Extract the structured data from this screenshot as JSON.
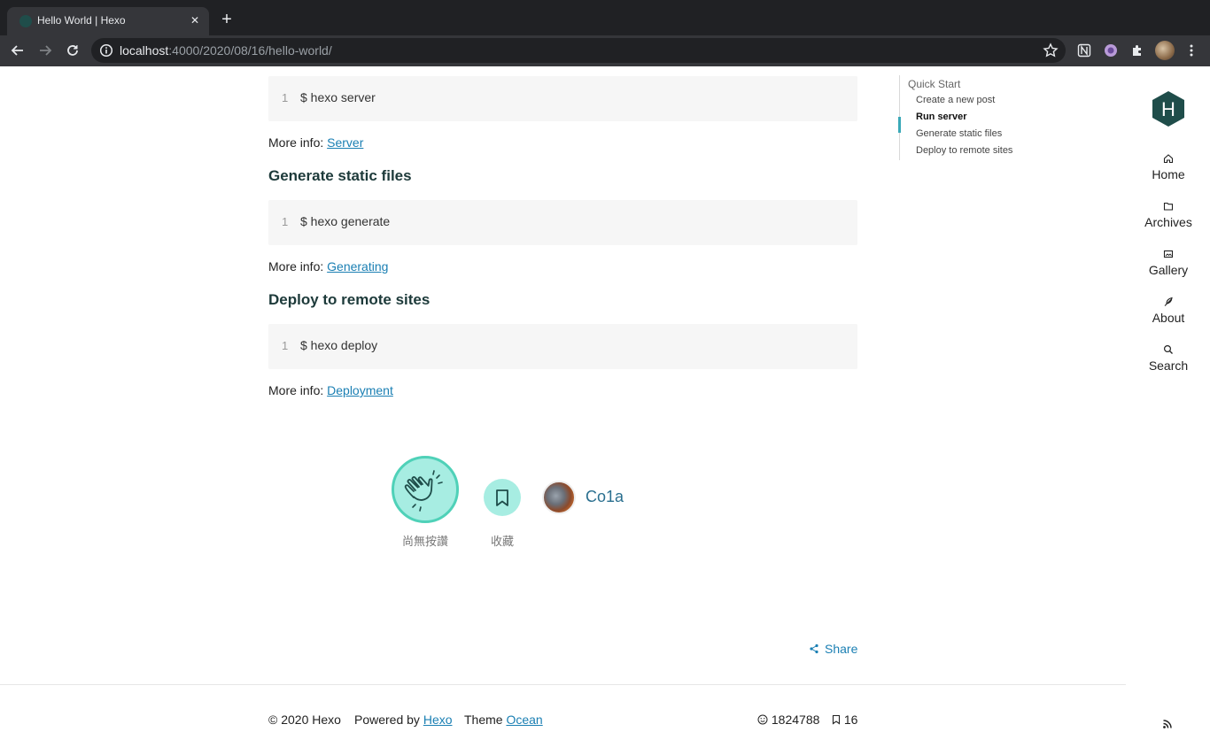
{
  "browser": {
    "tab_title": "Hello World | Hexo",
    "url_host": "localhost",
    "url_path": ":4000/2020/08/16/hello-world/"
  },
  "article": {
    "blocks": [
      {
        "line": "1",
        "code": "$ hexo server",
        "more_label": "More info:",
        "more_link": "Server"
      },
      {
        "heading": "Generate static files",
        "line": "1",
        "code": "$ hexo generate",
        "more_label": "More info:",
        "more_link": "Generating"
      },
      {
        "heading": "Deploy to remote sites",
        "line": "1",
        "code": "$ hexo deploy",
        "more_label": "More info:",
        "more_link": "Deployment"
      }
    ]
  },
  "toc": {
    "title": "Quick Start",
    "items": [
      {
        "label": "Create a new post",
        "active": false
      },
      {
        "label": "Run server",
        "active": true
      },
      {
        "label": "Generate static files",
        "active": false
      },
      {
        "label": "Deploy to remote sites",
        "active": false
      }
    ]
  },
  "sidebar": {
    "logo_letter": "H",
    "logo_color": "#1f4d4a",
    "items": [
      {
        "label": "Home",
        "icon": "home-icon"
      },
      {
        "label": "Archives",
        "icon": "folder-icon"
      },
      {
        "label": "Gallery",
        "icon": "image-icon"
      },
      {
        "label": "About",
        "icon": "feather-icon"
      },
      {
        "label": "Search",
        "icon": "search-icon"
      }
    ]
  },
  "reactions": {
    "clap_label": "尚無按讚",
    "bookmark_label": "收藏",
    "author": "Co1a",
    "accent": "#a7ede2"
  },
  "share": {
    "label": "Share"
  },
  "footer": {
    "copyright": "© 2020 Hexo",
    "powered_label": "Powered by",
    "powered_link": "Hexo",
    "theme_label": "Theme",
    "theme_link": "Ocean",
    "visitors": "1824788",
    "posts": "16"
  }
}
